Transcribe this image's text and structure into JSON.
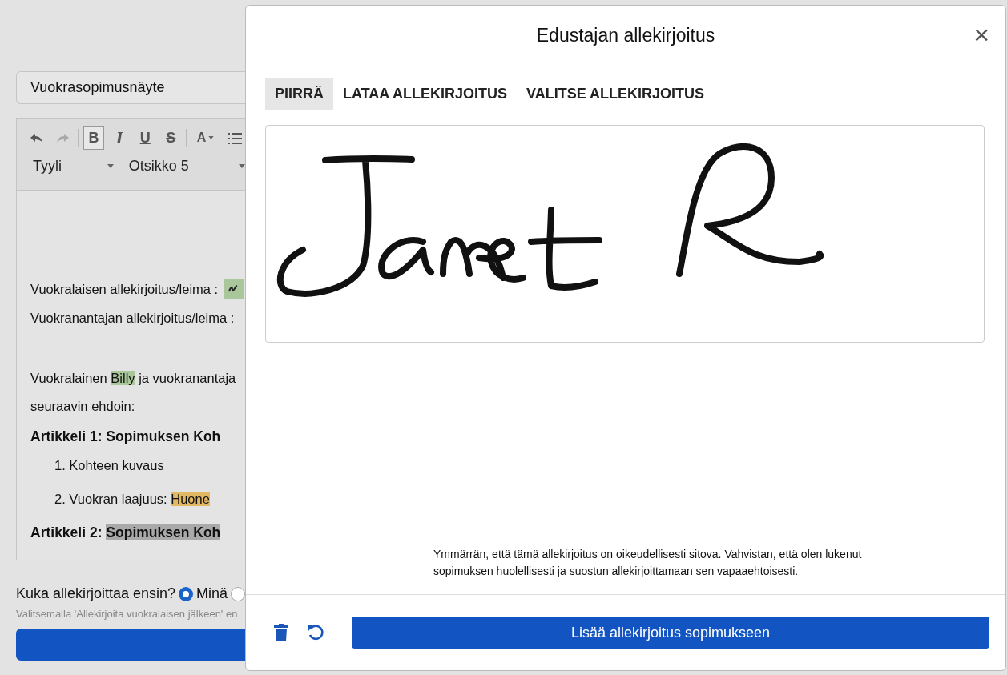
{
  "document": {
    "title_value": "Vuokrasopimusnäyte",
    "toolbar": [
      {
        "kind": "undo",
        "selected": false
      },
      {
        "kind": "redo",
        "selected": false
      },
      {
        "kind": "bold",
        "label": "B",
        "selected": true
      },
      {
        "kind": "italic",
        "label": "I",
        "selected": false
      },
      {
        "kind": "underline",
        "label": "U",
        "selected": false
      },
      {
        "kind": "strike",
        "label": "S",
        "selected": false
      },
      {
        "kind": "color",
        "label": "A",
        "selected": false
      },
      {
        "kind": "list",
        "selected": false
      }
    ],
    "style_dropdowns": [
      {
        "value": "Tyyli"
      },
      {
        "value": "Otsikko 5"
      }
    ],
    "body": [
      {
        "kind": "signature_line",
        "parts": [
          {
            "text": "Vuokralaisen allekirjoitus/leima :"
          }
        ]
      },
      {
        "kind": "paragraph",
        "parts": [
          {
            "text": "Vuokranantajan allekirjoitus/leima :"
          }
        ]
      },
      {
        "kind": "spacer"
      },
      {
        "kind": "paragraph",
        "parts": [
          {
            "text": "Vuokralainen "
          },
          {
            "text": "Billy",
            "color": "#a9c79b"
          },
          {
            "text": " ja vuokranantaja"
          }
        ]
      },
      {
        "kind": "paragraph",
        "parts": [
          {
            "text": "seuraavin ehdoin:"
          }
        ]
      },
      {
        "kind": "heading",
        "parts": [
          {
            "text": "Artikkeli 1: Sopimuksen Koh"
          }
        ]
      },
      {
        "kind": "list_item",
        "parts": [
          {
            "text": "1. Kohteen kuvaus"
          }
        ]
      },
      {
        "kind": "list_item",
        "parts": [
          {
            "text": "2. Vuokran laajuus: "
          },
          {
            "text": "Huone",
            "color": "#e3b862"
          }
        ]
      },
      {
        "kind": "heading",
        "parts": [
          {
            "text": "Artikkeli 2: "
          },
          {
            "text": "Sopimuksen Koh",
            "color": "#a9a9a9"
          }
        ]
      }
    ],
    "signing_order": {
      "label": "Kuka allekirjoittaa ensin?",
      "options": [
        {
          "label": "Minä",
          "selected": true
        },
        {
          "selected": false
        }
      ]
    },
    "hint": "Valitsemalla 'Allekirjoita vuokralaisen jälkeen' en"
  },
  "dialog": {
    "title": "Edustajan allekirjoitus",
    "close": "×",
    "tabs": [
      {
        "label": "PIIRRÄ",
        "selected": true
      },
      {
        "label": "LATAA ALLEKIRJOITUS",
        "selected": false
      },
      {
        "label": "VALITSE ALLEKIRJOITUS",
        "selected": false
      }
    ],
    "consent": "Ymmärrän, että tämä allekirjoitus on oikeudellisesti sitova. Vahvistan, että olen lukenut sopimuksen huolellisesti ja suostun allekirjoittamaan sen vapaaehtoisesti.",
    "submit": "Lisää allekirjoitus sopimukseen"
  }
}
